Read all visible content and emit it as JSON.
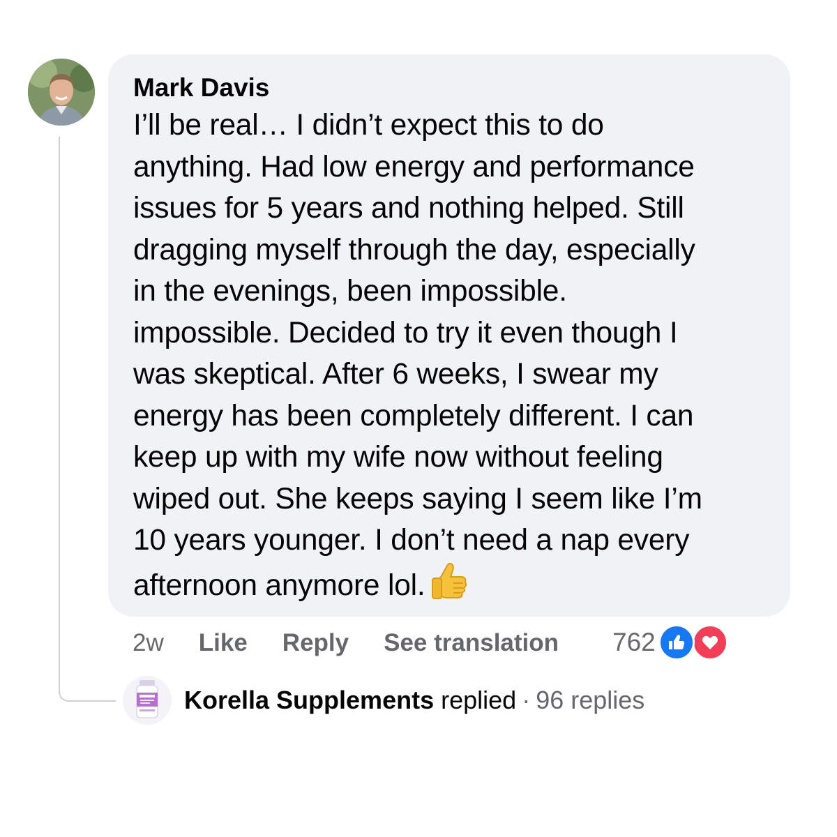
{
  "comment": {
    "author": "Mark Davis",
    "lines": [
      "I’ll be real… I didn’t expect this to do",
      "anything. Had low energy and performance",
      "issues for 5 years and nothing helped. Still",
      "dragging myself through the day, especially",
      "in the evenings, been impossible.",
      "impossible. Decided to try it even though I",
      "was skeptical. After 6 weeks, I swear my",
      "energy has been completely different. I can",
      "keep up with my wife now without feeling",
      "wiped out. She keeps saying I seem like I’m",
      "10 years younger. I don’t need a nap every",
      "afternoon anymore lol."
    ],
    "emoji": "thumbs-up-icon"
  },
  "actions": {
    "time": "2w",
    "like": "Like",
    "reply": "Reply",
    "translate": "See translation"
  },
  "reactions": {
    "count": "762",
    "icons": [
      "like-icon",
      "love-icon"
    ],
    "colors": {
      "like": "#1877f2",
      "love": "#f33e58"
    }
  },
  "reply_summary": {
    "page_name": "Korella Supplements",
    "action": "replied",
    "separator": "·",
    "replies": "96 replies"
  }
}
